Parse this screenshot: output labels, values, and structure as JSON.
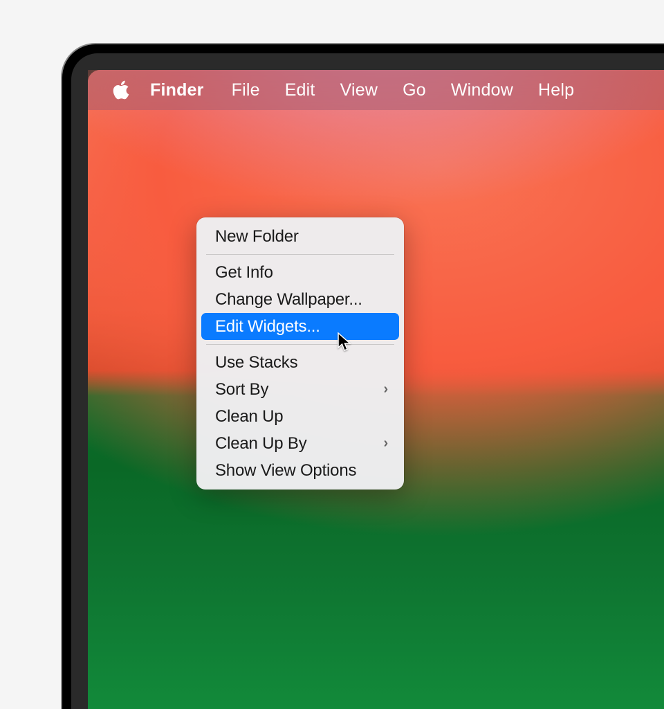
{
  "menubar": {
    "app_name": "Finder",
    "items": [
      "File",
      "Edit",
      "View",
      "Go",
      "Window",
      "Help"
    ]
  },
  "context_menu": {
    "groups": [
      [
        {
          "label": "New Folder",
          "submenu": false,
          "highlighted": false
        }
      ],
      [
        {
          "label": "Get Info",
          "submenu": false,
          "highlighted": false
        },
        {
          "label": "Change Wallpaper...",
          "submenu": false,
          "highlighted": false
        },
        {
          "label": "Edit Widgets...",
          "submenu": false,
          "highlighted": true
        }
      ],
      [
        {
          "label": "Use Stacks",
          "submenu": false,
          "highlighted": false
        },
        {
          "label": "Sort By",
          "submenu": true,
          "highlighted": false
        },
        {
          "label": "Clean Up",
          "submenu": false,
          "highlighted": false
        },
        {
          "label": "Clean Up By",
          "submenu": true,
          "highlighted": false
        },
        {
          "label": "Show View Options",
          "submenu": false,
          "highlighted": false
        }
      ]
    ]
  }
}
